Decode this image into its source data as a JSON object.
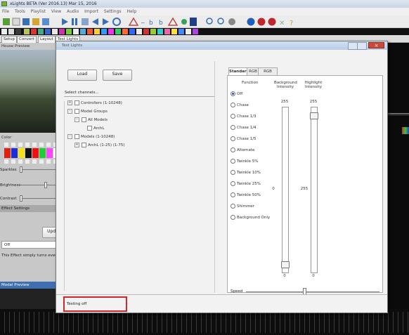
{
  "window": {
    "title": "xLights BETA (Ver 2016.13) Mar 15, 2016"
  },
  "menubar": {
    "items": [
      "File",
      "Tools",
      "Playlist",
      "View",
      "Audio",
      "Import",
      "Settings",
      "Help"
    ]
  },
  "app_tabs": [
    "Setup",
    "Convert",
    "Layout",
    "Test Lights"
  ],
  "left_panel": {
    "house_preview": "House Preview",
    "color": "Color",
    "sparkles": "Sparkles",
    "brightness": "Brightness",
    "contrast": "Contrast",
    "effect_settings": "Effect Settings",
    "update_button": "Update",
    "effect_dropdown": "Off",
    "effect_description": "This Effect simply turns every",
    "model_preview": "Model Preview"
  },
  "dialog": {
    "title": "Test Lights",
    "load_button": "Load",
    "save_button": "Save",
    "select_channels": "Select channels...",
    "tree": [
      {
        "label": "Controllers (1-10248)",
        "indent": 0,
        "expander": "+"
      },
      {
        "label": "Model Groups",
        "indent": 0,
        "expander": "-"
      },
      {
        "label": "All Models",
        "indent": 1,
        "expander": "-"
      },
      {
        "label": "ArchL",
        "indent": 2,
        "expander": ""
      },
      {
        "label": "Models (1-10248)",
        "indent": 0,
        "expander": "-"
      },
      {
        "label": "ArchL (1-25) (1-75)",
        "indent": 1,
        "expander": "+"
      }
    ],
    "tabs": [
      "Standard",
      "RGB",
      "RGB Cycle"
    ],
    "function_header": "Function",
    "background_header": "Background\nIntensity",
    "highlight_header": "Highlight\nIntensity",
    "functions": [
      "Off",
      "Chase",
      "Chase 1/3",
      "Chase 1/4",
      "Chase 1/5",
      "Alternate",
      "Twinkle 5%",
      "Twinkle 10%",
      "Twinkle 25%",
      "Twinkle 50%",
      "Shimmer",
      "Background Only"
    ],
    "selected_function": "Off",
    "bg_max": "255",
    "hl_max": "255",
    "bg_value": "0",
    "hl_value": "255",
    "bg_min": "0",
    "hl_min": "0",
    "speed_label": "Speed",
    "status": "Testing off"
  }
}
